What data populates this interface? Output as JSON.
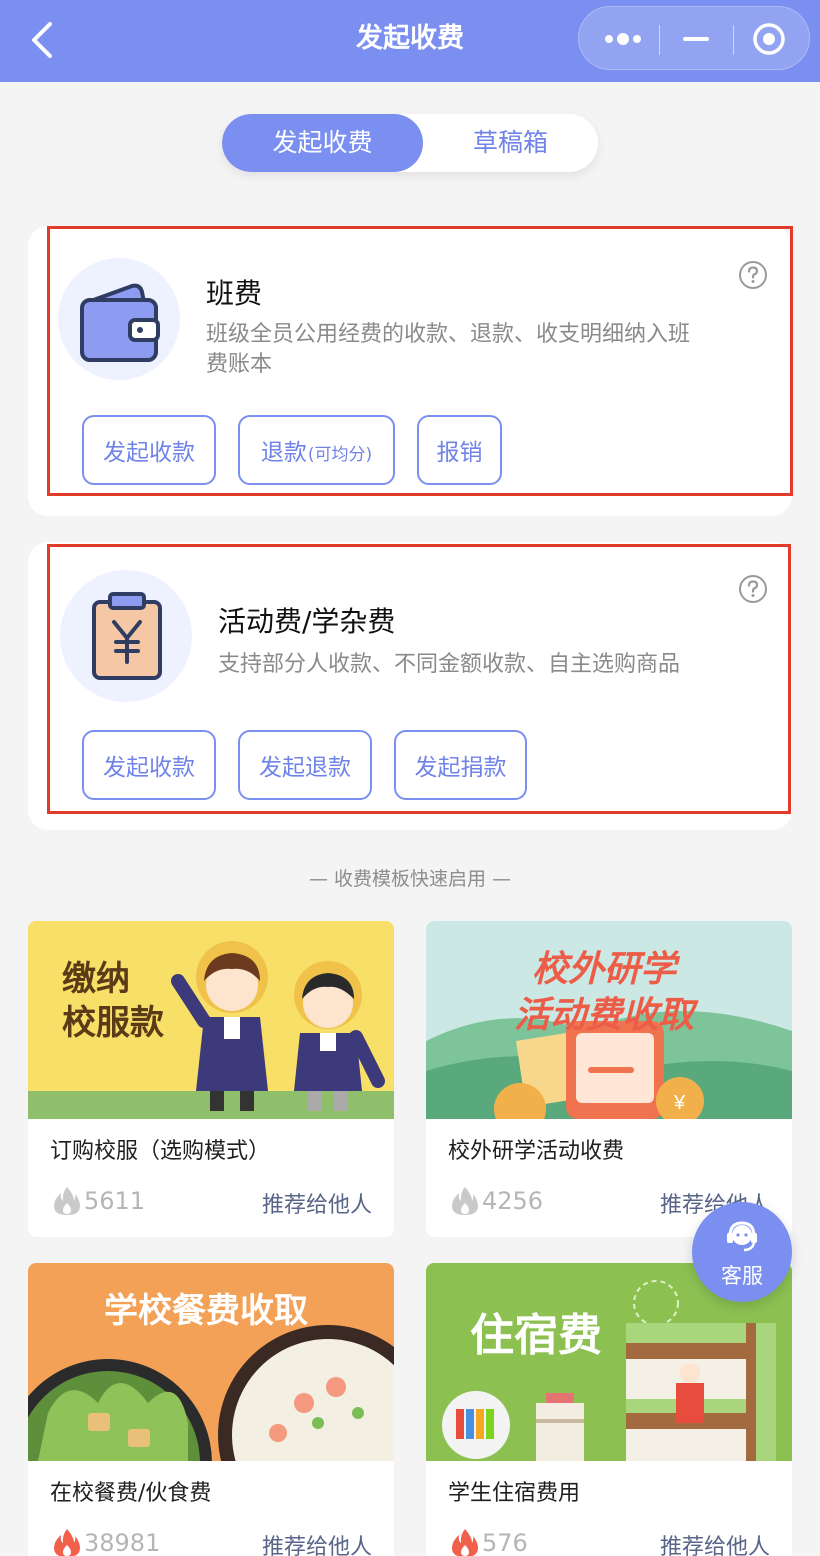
{
  "header": {
    "title": "发起收费"
  },
  "tabs": [
    {
      "label": "发起收费",
      "active": true
    },
    {
      "label": "草稿箱",
      "active": false
    }
  ],
  "class_fee": {
    "title": "班费",
    "description_line1": "班级全员公用经费的收款、退款、收支明细纳入班",
    "description_line2": "费账本",
    "buttons": {
      "collect": "发起收款",
      "refund": "退款",
      "refund_note": "(可均分)",
      "reimburse": "报销"
    },
    "icon": "wallet-icon"
  },
  "activity_fee": {
    "title": "活动费/学杂费",
    "description": "支持部分人收款、不同金额收款、自主选购商品",
    "buttons": {
      "collect": "发起收款",
      "refund": "发起退款",
      "donate": "发起捐款"
    },
    "icon": "yuan-clipboard-icon"
  },
  "templates_label": "— 收费模板快速启用 —",
  "templates": [
    {
      "banner_text_line1": "缴纳",
      "banner_text_line2": "校服款",
      "name": "订购校服（选购模式）",
      "count": "5611",
      "share": "推荐给他人",
      "hot": false
    },
    {
      "banner_text_line1": "校外研学",
      "banner_text_line2": "活动费收取",
      "name": "校外研学活动收费",
      "count": "4256",
      "share": "推荐给他人",
      "hot": false
    },
    {
      "banner_text_line1": "学校餐费收取",
      "name": "在校餐费/伙食费",
      "count": "38981",
      "share": "推荐给他人",
      "hot": true
    },
    {
      "banner_text_line1": "住宿费",
      "name": "学生住宿费用",
      "count": "576",
      "share": "推荐给他人",
      "hot": true
    }
  ],
  "service": {
    "label": "客服"
  },
  "colors": {
    "accent": "#7a8ff0",
    "highlight": "#e23b2a",
    "hot": "#f0604a"
  }
}
